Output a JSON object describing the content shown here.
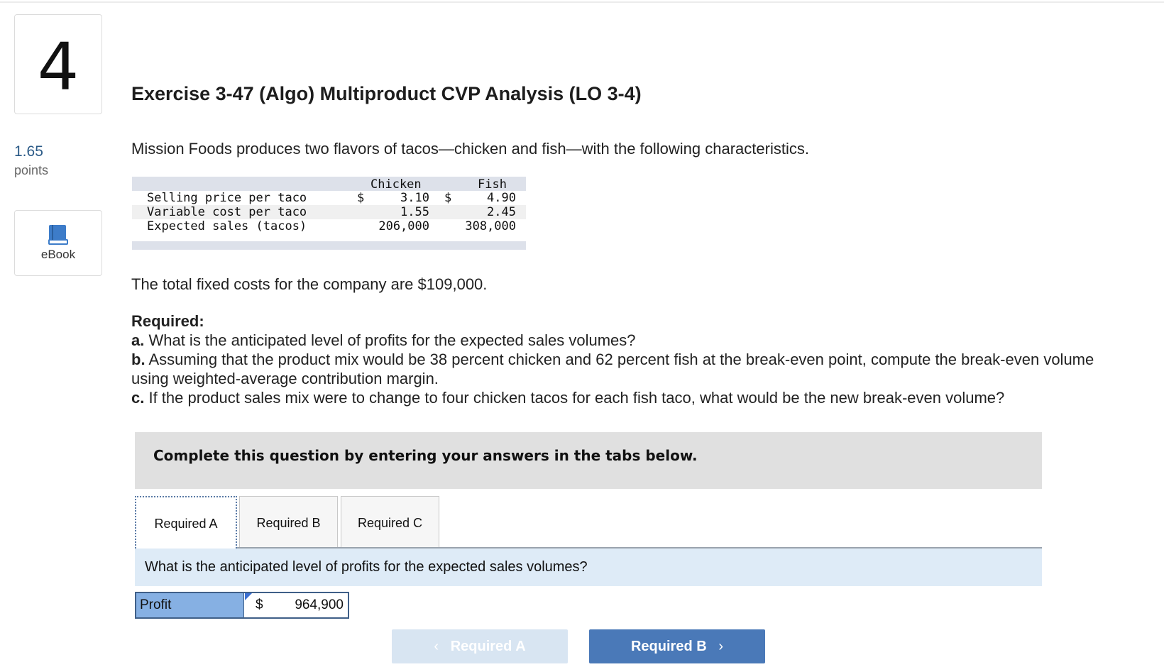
{
  "question": {
    "number": "4",
    "points_value": "1.65",
    "points_label": "points",
    "ebook_label": "eBook",
    "title": "Exercise 3-47 (Algo) Multiproduct CVP Analysis (LO 3-4)",
    "intro": "Mission Foods produces two flavors of tacos—chicken and fish—with the following characteristics.",
    "fixed_costs": "The total fixed costs for the company are $109,000."
  },
  "table": {
    "col_chicken": "Chicken",
    "col_fish": "Fish",
    "rows": [
      {
        "label": "Selling price per taco",
        "cur_c": "$",
        "chicken": "3.10",
        "cur_f": "$",
        "fish": "4.90"
      },
      {
        "label": "Variable cost per taco",
        "cur_c": "",
        "chicken": "1.55",
        "cur_f": "",
        "fish": "2.45"
      },
      {
        "label": "Expected sales (tacos)",
        "cur_c": "",
        "chicken": "206,000",
        "cur_f": "",
        "fish": "308,000"
      }
    ]
  },
  "required": {
    "heading": "Required:",
    "a_prefix": "a.",
    "a_text": " What is the anticipated level of profits for the expected sales volumes?",
    "b_prefix": "b.",
    "b_text": " Assuming that the product mix would be 38 percent chicken and 62 percent fish at the break-even point, compute the break-even volume using weighted-average contribution margin.",
    "c_prefix": "c.",
    "c_text": " If the product sales mix were to change to four chicken tacos for each fish taco, what would be the new break-even volume?"
  },
  "instructions": "Complete this question by entering your answers in the tabs below.",
  "tabs": [
    "Required A",
    "Required B",
    "Required C"
  ],
  "active_tab_question": "What is the anticipated level of profits for the expected sales volumes?",
  "answer": {
    "label": "Profit",
    "currency": "$",
    "value": "964,900"
  },
  "nav": {
    "prev_label": "Required A",
    "next_label": "Required B",
    "prev_chevron": "‹",
    "next_chevron": "›"
  },
  "icons": {
    "ebook": "book-icon"
  },
  "colors": {
    "accent": "#4a79b8",
    "points": "#2b5a87",
    "answer_label_bg": "#86b0e3",
    "question_bar_bg": "#deebf7"
  }
}
